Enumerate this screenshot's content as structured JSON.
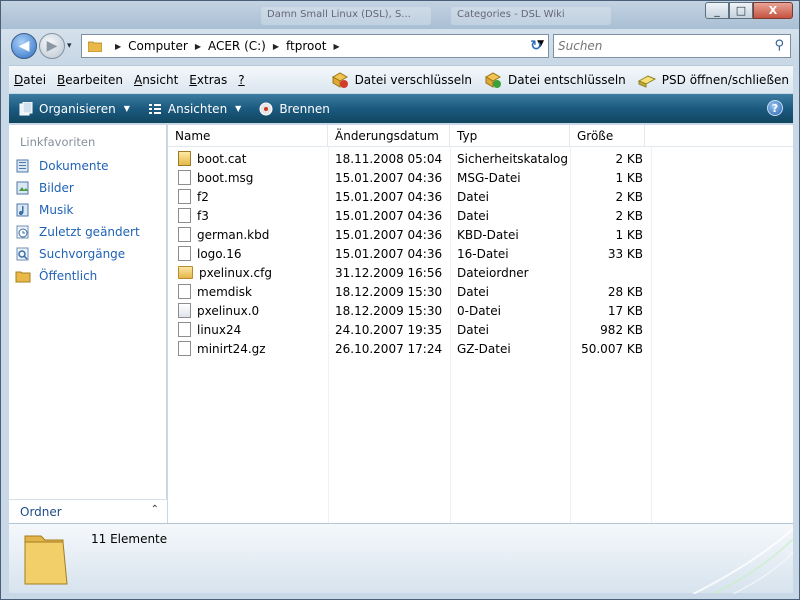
{
  "titlebar": {
    "ghost_tabs": [
      "Damn Small Linux (DSL), S...",
      "Categories - DSL Wiki"
    ],
    "buttons": {
      "minimize": "_",
      "maximize": "□",
      "close": "X"
    }
  },
  "nav": {
    "back_label": "◀",
    "forward_label": "▶",
    "history_label": "▾",
    "breadcrumb": [
      "Computer",
      "ACER (C:)",
      "ftproot"
    ],
    "address_dropdown": "▼",
    "refresh_label": "↻",
    "search_placeholder": "Suchen"
  },
  "menu": {
    "items": [
      {
        "accel": "D",
        "rest": "atei"
      },
      {
        "accel": "B",
        "rest": "earbeiten"
      },
      {
        "accel": "A",
        "rest": "nsicht"
      },
      {
        "accel": "E",
        "rest": "xtras"
      },
      {
        "accel": "?",
        "rest": ""
      }
    ],
    "tools": [
      "Datei verschlüsseln",
      "Datei entschlüsseln",
      "PSD öffnen/schließen"
    ]
  },
  "commandbar": {
    "organize": "Organisieren",
    "views": "Ansichten",
    "burn": "Brennen",
    "help": "?"
  },
  "leftpane": {
    "title": "Linkfavoriten",
    "links": [
      "Dokumente",
      "Bilder",
      "Musik",
      "Zuletzt geändert",
      "Suchvorgänge",
      "Öffentlich"
    ],
    "folders_label": "Ordner",
    "folders_chevron": "⌃"
  },
  "files": {
    "columns": [
      "Name",
      "Änderungsdatum",
      "Typ",
      "Größe"
    ],
    "rows": [
      {
        "name": "boot.cat",
        "date": "18.11.2008 05:04",
        "type": "Sicherheitskatalog",
        "size": "2 KB",
        "icon": "catalog-icon"
      },
      {
        "name": "boot.msg",
        "date": "15.01.2007 04:36",
        "type": "MSG-Datei",
        "size": "1 KB",
        "icon": "file-icon"
      },
      {
        "name": "f2",
        "date": "15.01.2007 04:36",
        "type": "Datei",
        "size": "2 KB",
        "icon": "file-icon"
      },
      {
        "name": "f3",
        "date": "15.01.2007 04:36",
        "type": "Datei",
        "size": "2 KB",
        "icon": "file-icon"
      },
      {
        "name": "german.kbd",
        "date": "15.01.2007 04:36",
        "type": "KBD-Datei",
        "size": "1 KB",
        "icon": "file-icon"
      },
      {
        "name": "logo.16",
        "date": "15.01.2007 04:36",
        "type": "16-Datei",
        "size": "33 KB",
        "icon": "file-icon"
      },
      {
        "name": "pxelinux.cfg",
        "date": "31.12.2009 16:56",
        "type": "Dateiordner",
        "size": "",
        "icon": "folder-icon"
      },
      {
        "name": "memdisk",
        "date": "18.12.2009 15:30",
        "type": "Datei",
        "size": "28 KB",
        "icon": "file-icon"
      },
      {
        "name": "pxelinux.0",
        "date": "18.12.2009 15:30",
        "type": "0-Datei",
        "size": "17 KB",
        "icon": "system-file-icon"
      },
      {
        "name": "linux24",
        "date": "24.10.2007 19:35",
        "type": "Datei",
        "size": "982 KB",
        "icon": "file-icon"
      },
      {
        "name": "minirt24.gz",
        "date": "26.10.2007 17:24",
        "type": "GZ-Datei",
        "size": "50.007 KB",
        "icon": "file-icon"
      }
    ]
  },
  "details": {
    "count_label": "11 Elemente"
  },
  "colors": {
    "command_bar": "#1c5a80",
    "link": "#1f62b5",
    "pane_title": "#86909c"
  }
}
